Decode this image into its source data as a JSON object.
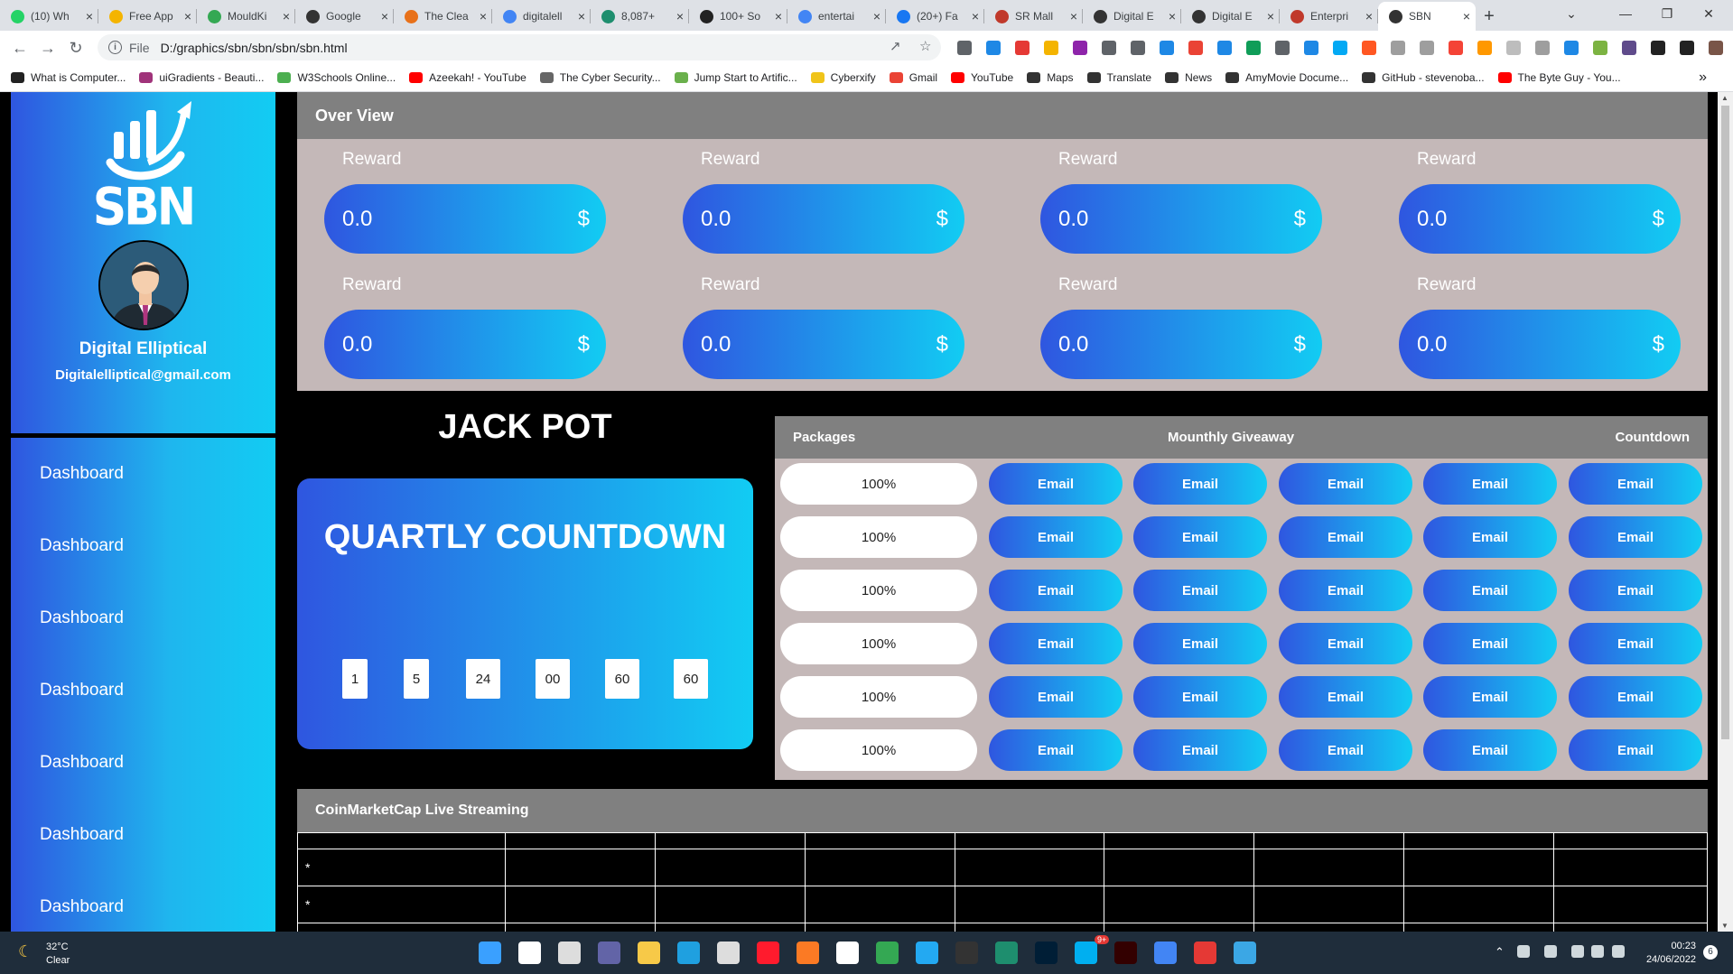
{
  "browser": {
    "tabs": [
      {
        "label": "(10) Wh",
        "color": "#25d366"
      },
      {
        "label": "Free App",
        "color": "#f4b400"
      },
      {
        "label": "MouldKi",
        "color": "#34a853"
      },
      {
        "label": "Google",
        "color": "#333333"
      },
      {
        "label": "The Clea",
        "color": "#e8711a"
      },
      {
        "label": "digitalell",
        "color": "#4285f4"
      },
      {
        "label": "8,087+",
        "color": "#1e8e6e"
      },
      {
        "label": "100+ So",
        "color": "#222222"
      },
      {
        "label": "entertai",
        "color": "#4285f4"
      },
      {
        "label": "(20+) Fa",
        "color": "#1877f2"
      },
      {
        "label": "SR Mall",
        "color": "#c0392b"
      },
      {
        "label": "Digital E",
        "color": "#333333"
      },
      {
        "label": "Digital E",
        "color": "#333333"
      },
      {
        "label": "Enterpri",
        "color": "#c0392b"
      },
      {
        "label": "SBN",
        "color": "#333333"
      }
    ],
    "close_glyph": "×",
    "new_tab_glyph": "+",
    "address_protocol": "File",
    "address_path": "D:/graphics/sbn/sbn/sbn/sbn.html",
    "bookmarks": [
      {
        "label": "What is Computer...",
        "color": "#222222"
      },
      {
        "label": "uiGradients - Beauti...",
        "color": "#a0337a"
      },
      {
        "label": "W3Schools Online...",
        "color": "#4caf50"
      },
      {
        "label": "Azeekah! - YouTube",
        "color": "#ff0000"
      },
      {
        "label": "The Cyber Security...",
        "color": "#666666"
      },
      {
        "label": "Jump Start to Artific...",
        "color": "#6ab04c"
      },
      {
        "label": "Cyberxify",
        "color": "#f0c419"
      },
      {
        "label": "Gmail",
        "color": "#ea4335"
      },
      {
        "label": "YouTube",
        "color": "#ff0000"
      },
      {
        "label": "Maps",
        "color": "#333333"
      },
      {
        "label": "Translate",
        "color": "#333333"
      },
      {
        "label": "News",
        "color": "#333333"
      },
      {
        "label": "AmyMovie Docume...",
        "color": "#333333"
      },
      {
        "label": "GitHub - stevenoba...",
        "color": "#333333"
      },
      {
        "label": "The Byte Guy - You...",
        "color": "#ff0000"
      }
    ],
    "more_bookmarks_glyph": "»"
  },
  "sidebar": {
    "brand": "SBN",
    "user_name": "Digital Elliptical",
    "user_email": "Digitalelliptical@gmail.com",
    "nav": [
      "Dashboard",
      "Dashboard",
      "Dashboard",
      "Dashboard",
      "Dashboard",
      "Dashboard",
      "Dashboard"
    ]
  },
  "overview": {
    "title": "Over View",
    "rewards": [
      {
        "label": "Reward",
        "value": "0.0",
        "currency": "$"
      },
      {
        "label": "Reward",
        "value": "0.0",
        "currency": "$"
      },
      {
        "label": "Reward",
        "value": "0.0",
        "currency": "$"
      },
      {
        "label": "Reward",
        "value": "0.0",
        "currency": "$"
      },
      {
        "label": "Reward",
        "value": "0.0",
        "currency": "$"
      },
      {
        "label": "Reward",
        "value": "0.0",
        "currency": "$"
      },
      {
        "label": "Reward",
        "value": "0.0",
        "currency": "$"
      },
      {
        "label": "Reward",
        "value": "0.0",
        "currency": "$"
      }
    ]
  },
  "jackpot": {
    "title": "JACK POT",
    "countdown_title": "QUARTLY COUNTDOWN",
    "countdown_values": [
      "1",
      "5",
      "24",
      "00",
      "60",
      "60"
    ]
  },
  "packages": {
    "headers": {
      "packages": "Packages",
      "giveaway": "Mounthly Giveaway",
      "countdown": "Countdown"
    },
    "rows": [
      {
        "percent": "100%",
        "emails": [
          "Email",
          "Email",
          "Email",
          "Email",
          "Email"
        ]
      },
      {
        "percent": "100%",
        "emails": [
          "Email",
          "Email",
          "Email",
          "Email",
          "Email"
        ]
      },
      {
        "percent": "100%",
        "emails": [
          "Email",
          "Email",
          "Email",
          "Email",
          "Email"
        ]
      },
      {
        "percent": "100%",
        "emails": [
          "Email",
          "Email",
          "Email",
          "Email",
          "Email"
        ]
      },
      {
        "percent": "100%",
        "emails": [
          "Email",
          "Email",
          "Email",
          "Email",
          "Email"
        ]
      },
      {
        "percent": "100%",
        "emails": [
          "Email",
          "Email",
          "Email",
          "Email",
          "Email"
        ]
      }
    ]
  },
  "coinmarketcap": {
    "title": "CoinMarketCap Live Streaming",
    "rows": [
      [
        "",
        "",
        "",
        "",
        "",
        "",
        "",
        "",
        ""
      ],
      [
        "*",
        "",
        "",
        "",
        "",
        "",
        "",
        "",
        ""
      ],
      [
        "*",
        "",
        "",
        "",
        "",
        "",
        "",
        "",
        ""
      ],
      [
        "",
        "",
        "",
        "",
        "",
        "",
        "",
        "",
        ""
      ]
    ]
  },
  "taskbar": {
    "temperature": "32°C",
    "weather": "Clear",
    "time": "00:23",
    "date": "24/06/2022",
    "notification_count": "6",
    "badge_count": "9+"
  },
  "colors": {
    "gradient_start": "#2f56e0",
    "gradient_end": "#12ccf3",
    "panel_header": "#808080",
    "panel_body": "#c4b8b8"
  }
}
